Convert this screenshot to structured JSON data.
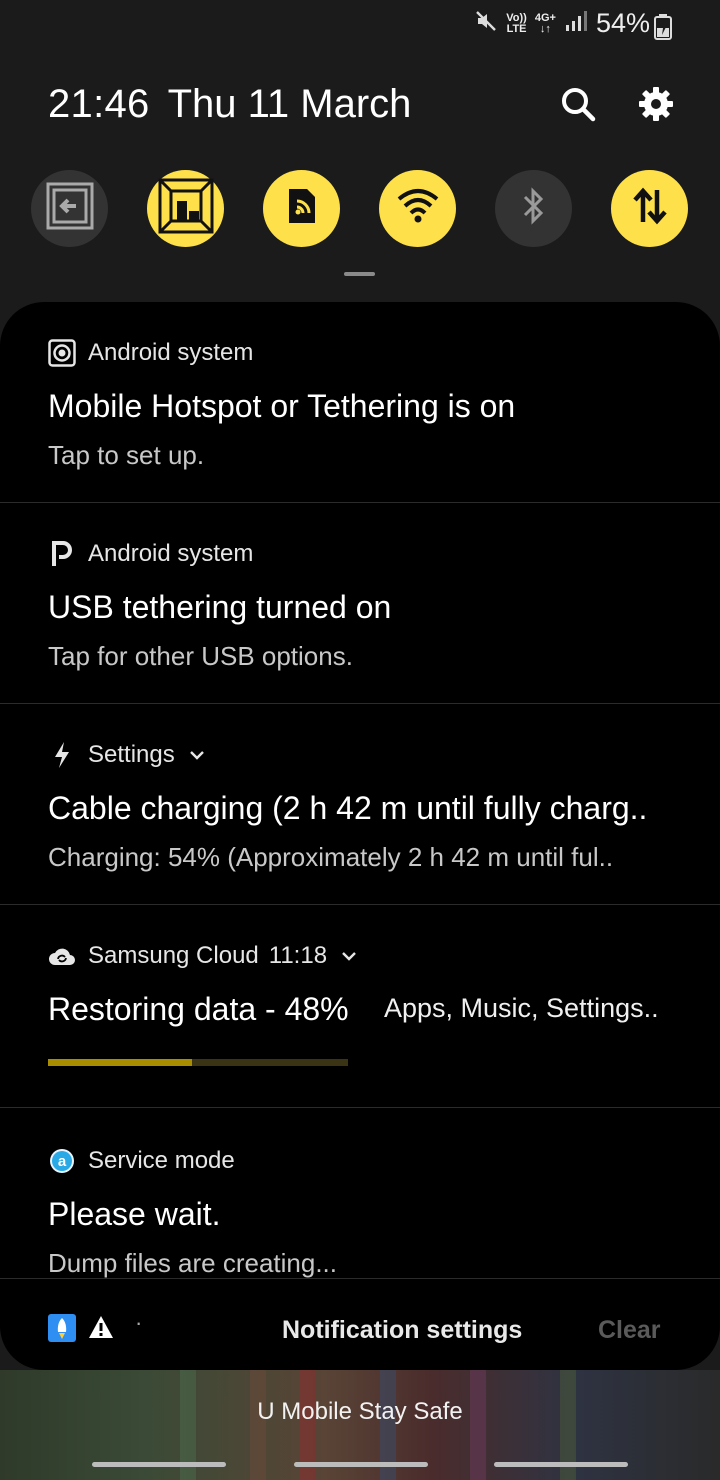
{
  "status_bar": {
    "volte": "Vo))",
    "lte": "LTE",
    "net": "4G+",
    "battery": "54%",
    "icons": [
      "mute-icon",
      "volte-icon",
      "data-4g-icon",
      "signal-icon",
      "battery-charging-icon"
    ]
  },
  "header": {
    "time": "21:46",
    "date": "Thu 11 March",
    "icons": [
      "search-icon",
      "settings-gear-icon"
    ]
  },
  "quick_settings": [
    {
      "name": "screen-mirroring",
      "state": "off"
    },
    {
      "name": "dolby-atmos",
      "state": "on"
    },
    {
      "name": "mobile-hotspot",
      "state": "on"
    },
    {
      "name": "wifi",
      "state": "on"
    },
    {
      "name": "bluetooth",
      "state": "off"
    },
    {
      "name": "mobile-data",
      "state": "on"
    }
  ],
  "notifications": [
    {
      "app": "Android system",
      "title": "Mobile Hotspot or Tethering is on",
      "text": "Tap to set up.",
      "icon": "hotspot-target-icon"
    },
    {
      "app": "Android system",
      "title": "USB tethering turned on",
      "text": "Tap for other USB options.",
      "icon": "usb-p-icon"
    },
    {
      "app": "Settings",
      "title": "Cable charging (2 h 42 m until fully charg..",
      "text": "Charging: 54% (Approximately 2 h 42 m until ful..",
      "icon": "charging-bolt-icon"
    },
    {
      "app": "Samsung Cloud",
      "time": "11:18",
      "title": "Restoring data - 48%",
      "text": "Apps, Music, Settings..",
      "progress": 0.48,
      "icon": "cloud-sync-icon"
    },
    {
      "app": "Service mode",
      "title": "Please wait.",
      "text": "Dump files are creating...",
      "icon": "service-a-icon"
    }
  ],
  "footer": {
    "settings_label": "Notification settings",
    "clear_label": "Clear",
    "dot": "·",
    "icons": [
      "rocket-app-icon",
      "warning-icon"
    ]
  },
  "carrier": "U Mobile Stay Safe",
  "colors": {
    "accent_on": "#fde04a",
    "tile_off": "#333333",
    "progress": "#a88d00",
    "clear_disabled": "#5a5a5a"
  }
}
